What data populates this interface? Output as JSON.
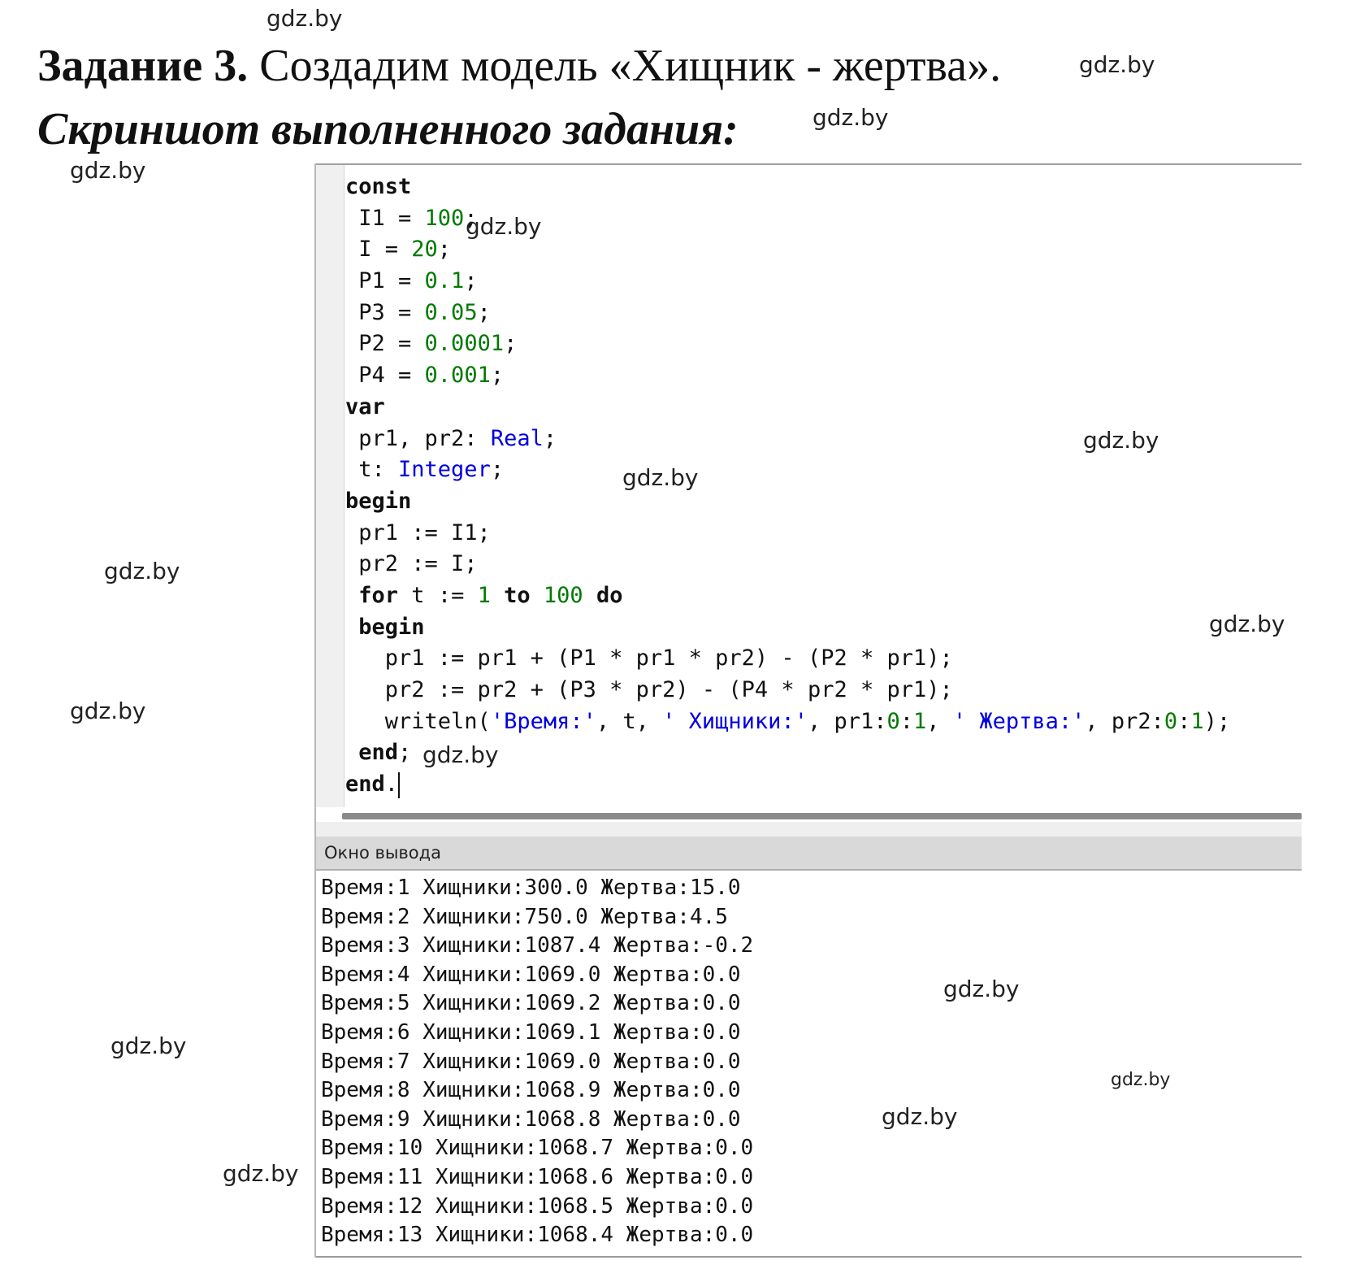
{
  "heading": {
    "label": "Задание 3.",
    "text": " Создадим модель «Хищник - жертва»."
  },
  "subheading": "Скриншот выполненного задания:",
  "watermark": "gdz.by",
  "ide": {
    "output_title": "Окно вывода",
    "output_lines": [
      "Время:1 Хищники:300.0 Жертва:15.0",
      "Время:2 Хищники:750.0 Жертва:4.5",
      "Время:3 Хищники:1087.4 Жертва:-0.2",
      "Время:4 Хищники:1069.0 Жертва:0.0",
      "Время:5 Хищники:1069.2 Жертва:0.0",
      "Время:6 Хищники:1069.1 Жертва:0.0",
      "Время:7 Хищники:1069.0 Жертва:0.0",
      "Время:8 Хищники:1068.9 Жертва:0.0",
      "Время:9 Хищники:1068.8 Жертва:0.0",
      "Время:10 Хищники:1068.7 Жертва:0.0",
      "Время:11 Хищники:1068.6 Жертва:0.0",
      "Время:12 Хищники:1068.5 Жертва:0.0",
      "Время:13 Хищники:1068.4 Жертва:0.0"
    ],
    "code_lines": [
      [
        {
          "t": "const",
          "c": "kw"
        }
      ],
      [
        {
          "t": " I1 = "
        },
        {
          "t": "100",
          "c": "num"
        },
        {
          "t": ";"
        }
      ],
      [
        {
          "t": " I = "
        },
        {
          "t": "20",
          "c": "num"
        },
        {
          "t": ";"
        }
      ],
      [
        {
          "t": " P1 = "
        },
        {
          "t": "0.1",
          "c": "num"
        },
        {
          "t": ";"
        }
      ],
      [
        {
          "t": " P3 = "
        },
        {
          "t": "0.05",
          "c": "num"
        },
        {
          "t": ";"
        }
      ],
      [
        {
          "t": " P2 = "
        },
        {
          "t": "0.0001",
          "c": "num"
        },
        {
          "t": ";"
        }
      ],
      [
        {
          "t": " P4 = "
        },
        {
          "t": "0.001",
          "c": "num"
        },
        {
          "t": ";"
        }
      ],
      [
        {
          "t": "var",
          "c": "kw"
        }
      ],
      [
        {
          "t": " pr1, pr2: "
        },
        {
          "t": "Real",
          "c": "type"
        },
        {
          "t": ";"
        }
      ],
      [
        {
          "t": " t: "
        },
        {
          "t": "Integer",
          "c": "type"
        },
        {
          "t": ";"
        }
      ],
      [
        {
          "t": "begin",
          "c": "kw"
        }
      ],
      [
        {
          "t": " pr1 := I1;"
        }
      ],
      [
        {
          "t": " pr2 := I;"
        }
      ],
      [
        {
          "t": " "
        },
        {
          "t": "for",
          "c": "kw"
        },
        {
          "t": " t := "
        },
        {
          "t": "1",
          "c": "num"
        },
        {
          "t": " "
        },
        {
          "t": "to",
          "c": "kw"
        },
        {
          "t": " "
        },
        {
          "t": "100",
          "c": "num"
        },
        {
          "t": " "
        },
        {
          "t": "do",
          "c": "kw"
        }
      ],
      [
        {
          "t": " "
        },
        {
          "t": "begin",
          "c": "kw"
        }
      ],
      [
        {
          "t": "   pr1 := pr1 + (P1 * pr1 * pr2) - (P2 * pr1);"
        }
      ],
      [
        {
          "t": "   pr2 := pr2 + (P3 * pr2) - (P4 * pr2 * pr1);"
        }
      ],
      [
        {
          "t": "   writeln("
        },
        {
          "t": "'Время:'",
          "c": "str"
        },
        {
          "t": ", t, "
        },
        {
          "t": "' Хищники:'",
          "c": "str"
        },
        {
          "t": ", pr1:"
        },
        {
          "t": "0",
          "c": "num"
        },
        {
          "t": ":"
        },
        {
          "t": "1",
          "c": "num"
        },
        {
          "t": ", "
        },
        {
          "t": "' Жертва:'",
          "c": "str"
        },
        {
          "t": ", pr2:"
        },
        {
          "t": "0",
          "c": "num"
        },
        {
          "t": ":"
        },
        {
          "t": "1",
          "c": "num"
        },
        {
          "t": ");"
        }
      ],
      [
        {
          "t": " "
        },
        {
          "t": "end",
          "c": "kw"
        },
        {
          "t": ";"
        }
      ],
      [
        {
          "t": "end",
          "c": "kw"
        },
        {
          "t": "."
        }
      ]
    ]
  }
}
